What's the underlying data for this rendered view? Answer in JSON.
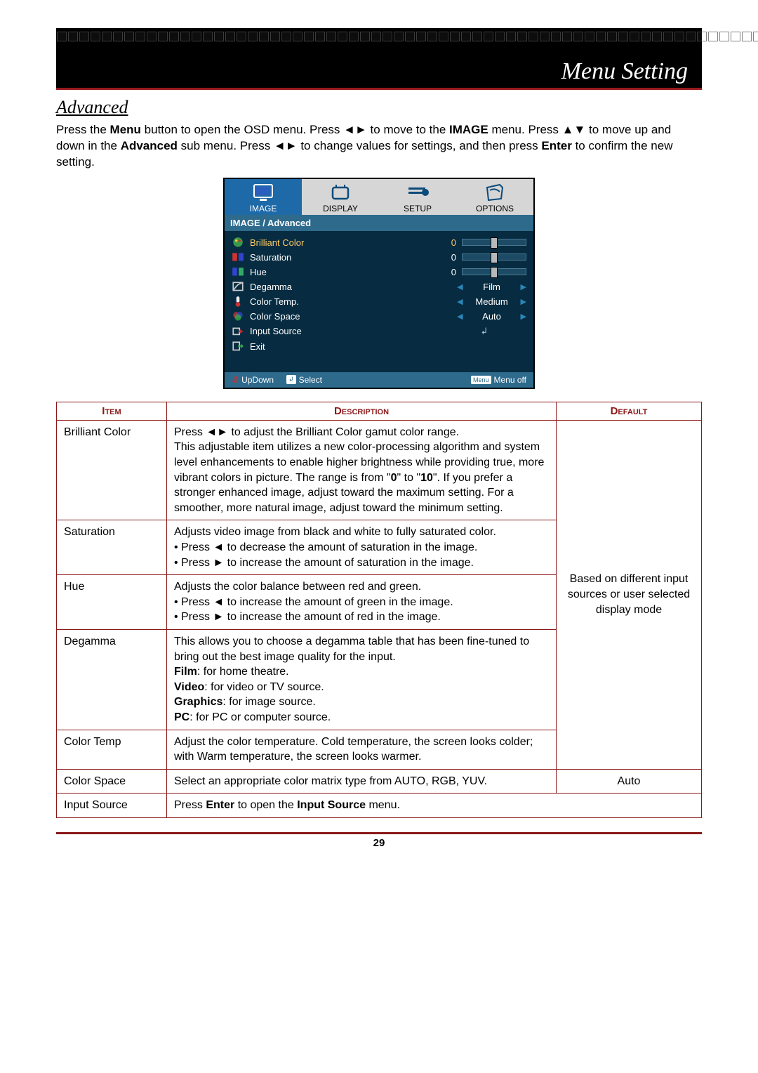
{
  "header": {
    "title": "Menu Setting"
  },
  "section": {
    "title": "Advanced"
  },
  "intro": {
    "part1": "Press the ",
    "menu_b": "Menu",
    "part2": " button to open the OSD menu. Press ",
    "part3": " to move to the ",
    "image_b": "IMAGE",
    "part4": " menu. Press ",
    "part5": " to move up and down in the ",
    "adv_b": "Advanced",
    "part6": " sub menu. Press ",
    "part7": " to change values for settings, and then press ",
    "enter_b": "Enter",
    "part8": " to confirm the new setting."
  },
  "osd": {
    "tabs": [
      {
        "label": "IMAGE",
        "active": true
      },
      {
        "label": "DISPLAY",
        "active": false
      },
      {
        "label": "SETUP",
        "active": false
      },
      {
        "label": "OPTIONS",
        "active": false
      }
    ],
    "breadcrumb": "IMAGE / Advanced",
    "rows": [
      {
        "label": "Brilliant Color",
        "type": "slider",
        "value": "0",
        "selected": true
      },
      {
        "label": "Saturation",
        "type": "slider",
        "value": "0"
      },
      {
        "label": "Hue",
        "type": "slider",
        "value": "0"
      },
      {
        "label": "Degamma",
        "type": "select",
        "value": "Film"
      },
      {
        "label": "Color Temp.",
        "type": "select",
        "value": "Medium"
      },
      {
        "label": "Color Space",
        "type": "select",
        "value": "Auto"
      },
      {
        "label": "Input Source",
        "type": "enter"
      },
      {
        "label": "Exit",
        "type": "exit"
      }
    ],
    "footer": {
      "updown": "UpDown",
      "select": "Select",
      "menuoff": "Menu off",
      "menukey": "Menu"
    }
  },
  "table": {
    "headers": {
      "item": "Item",
      "desc": "Description",
      "default": "Default"
    },
    "default_shared": "Based on different input sources or user selected display mode",
    "rows": {
      "brilliant": {
        "item": "Brilliant Color",
        "d1": "Press ",
        "d2": " to adjust the Brilliant Color gamut color range.",
        "d3": "This adjustable item utilizes a new color-processing algorithm and system level enhancements to enable higher brightness while providing true, more vibrant colors in picture. The range is from \"",
        "d3b0": "0",
        "d3mid": "\" to \"",
        "d3b10": "10",
        "d3end": "\". If you prefer a stronger enhanced image, adjust toward the maximum setting. For a smoother, more natural image, adjust toward the minimum setting."
      },
      "saturation": {
        "item": "Saturation",
        "d1": "Adjusts video image from black and white to fully saturated color.",
        "d2a": "• Press ",
        "d2b": " to decrease the amount of saturation in the image.",
        "d3a": "• Press ",
        "d3b": " to increase the amount of saturation in the image."
      },
      "hue": {
        "item": "Hue",
        "d1": "Adjusts the color balance between red and green.",
        "d2a": "• Press ",
        "d2b": " to increase the amount of green in the image.",
        "d3a": "• Press ",
        "d3b": " to increase the amount of red in the image."
      },
      "degamma": {
        "item": "Degamma",
        "d1": "This allows you to choose a degamma table that has been fine-tuned to bring out the best image quality for the input.",
        "film_b": "Film",
        "film_t": ": for home theatre.",
        "video_b": "Video",
        "video_t": ": for video or TV source.",
        "graphics_b": "Graphics",
        "graphics_t": ": for image source.",
        "pc_b": "PC",
        "pc_t": ": for PC or computer source."
      },
      "colortemp": {
        "item": "Color Temp",
        "desc": "Adjust the color temperature. Cold temperature, the screen looks colder; with Warm temperature, the screen looks warmer."
      },
      "colorspace": {
        "item": "Color Space",
        "desc": "Select an appropriate color matrix type from AUTO, RGB, YUV.",
        "default": "Auto"
      },
      "inputsource": {
        "item": "Input Source",
        "d1": "Press ",
        "enter_b": "Enter",
        "d2": " to open the ",
        "is_b": "Input Source",
        "d3": " menu."
      }
    }
  },
  "page_number": "29"
}
